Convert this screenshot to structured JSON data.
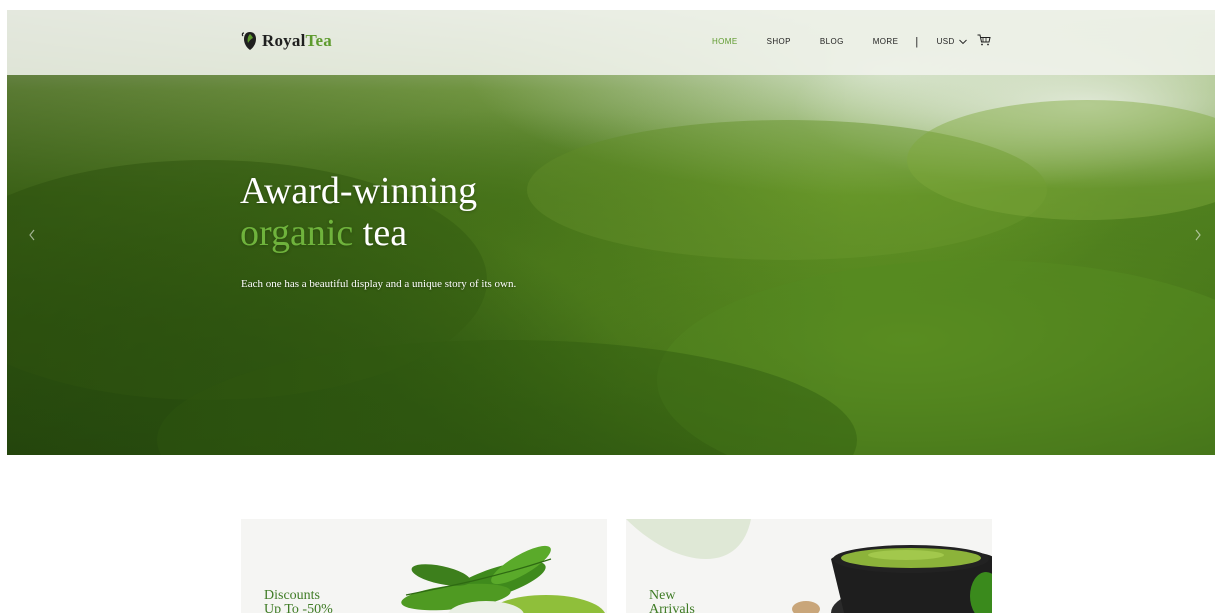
{
  "header": {
    "logo": {
      "text_primary": "Royal",
      "text_accent": "Tea"
    },
    "nav": [
      {
        "label": "HOME",
        "active": true
      },
      {
        "label": "SHOP",
        "active": false
      },
      {
        "label": "BLOG",
        "active": false
      },
      {
        "label": "MORE",
        "active": false
      }
    ],
    "separator": "|",
    "currency": "USD",
    "cart_icon": "cart-icon"
  },
  "hero": {
    "title_line1": "Award-winning",
    "title_accent": "organic",
    "title_rest": " tea",
    "subtitle": "Each one has a beautiful display and a unique story of its own."
  },
  "promos": [
    {
      "line1": "Discounts",
      "line2": "Up To -50%"
    },
    {
      "line1": "New",
      "line2": "Arrivals"
    }
  ],
  "colors": {
    "accent": "#5e9b2e",
    "hero_accent": "#6fb33c",
    "promo_text": "#3e7b24"
  }
}
